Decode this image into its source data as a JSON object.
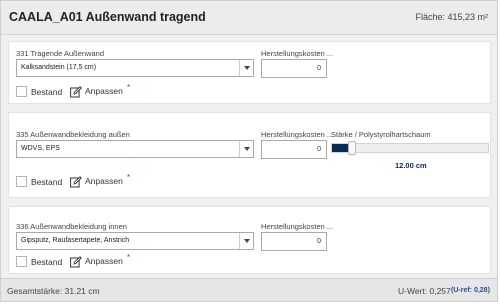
{
  "header": {
    "title": "CAALA_A01 Außenwand tragend",
    "area": "Fläche: 415,23 m²"
  },
  "layers": [
    {
      "name": "331 Tragende Außenwand",
      "selected": "Kalksandstein (17,5 cm)",
      "cost_label": "Herstellungskosten ...",
      "cost_value": "0",
      "bestand_label": "Bestand",
      "adjust_label": "Anpassen",
      "required_mark": "*"
    },
    {
      "name": "335 Außenwandbekleidung außen",
      "selected": "WDVS, EPS",
      "cost_label": "Herstellungskosten ...",
      "cost_value": "0",
      "thickness_label": "Stärke / Polystyrolhartschaum",
      "thickness_value": "12.00 cm",
      "slider_fraction": 0.1,
      "bestand_label": "Bestand",
      "adjust_label": "Anpassen",
      "required_mark": "*"
    },
    {
      "name": "336 Außenwandbekleidung innen",
      "selected": "Gipsputz, Raufasertapete, Anstrich",
      "cost_label": "Herstellungskosten ...",
      "cost_value": "0",
      "bestand_label": "Bestand",
      "adjust_label": "Anpassen",
      "required_mark": "*"
    }
  ],
  "footer": {
    "total_thickness": "Gesamtstärke: 31.21 cm",
    "u_value": "U-Wert: 0,257",
    "u_ref": "(U-ref: 0,28)"
  },
  "colors": {
    "accent": "#0a2a5a",
    "required": "#cc2222"
  }
}
